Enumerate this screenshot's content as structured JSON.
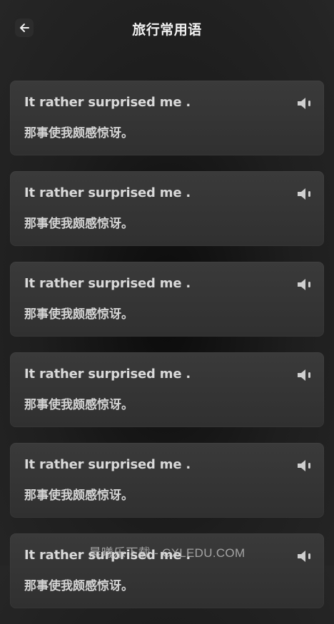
{
  "header": {
    "title": "旅行常用语",
    "back_icon": "arrow-left-icon"
  },
  "phrases": [
    {
      "en": "It rather surprised me .",
      "zh": "那事使我颇感惊讶。",
      "icon": "speaker-icon"
    },
    {
      "en": "It rather surprised me .",
      "zh": "那事使我颇感惊讶。",
      "icon": "speaker-icon"
    },
    {
      "en": "It rather surprised me .",
      "zh": "那事使我颇感惊讶。",
      "icon": "speaker-icon"
    },
    {
      "en": "It rather surprised me .",
      "zh": "那事使我颇感惊讶。",
      "icon": "speaker-icon"
    },
    {
      "en": "It rather surprised me .",
      "zh": "那事使我颇感惊讶。",
      "icon": "speaker-icon"
    },
    {
      "en": "It rather surprised me .",
      "zh": "那事使我颇感惊讶。",
      "icon": "speaker-icon"
    }
  ],
  "watermark": "晨曦乐下载 - CXLEDU.COM",
  "colors": {
    "background": "#1e1e1e",
    "card": "#363636",
    "text": "#d9d9d9"
  }
}
